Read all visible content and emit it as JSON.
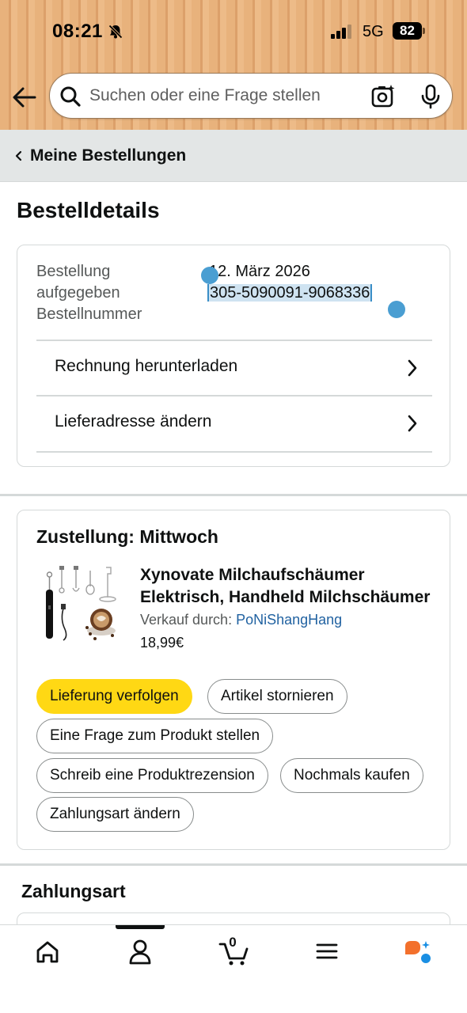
{
  "status_bar": {
    "time": "08:21",
    "network": "5G",
    "battery": "82"
  },
  "search": {
    "placeholder": "Suchen oder eine Frage stellen"
  },
  "breadcrumb": {
    "label": "Meine Bestellungen"
  },
  "page": {
    "title": "Bestelldetails"
  },
  "order_info": {
    "label_placed_line1": "Bestellung",
    "label_placed_line2": "aufgegeben",
    "label_number": "Bestellnummer",
    "date": "12. März 2026",
    "order_number": "305-5090091-9068336",
    "rows": [
      {
        "label": "Rechnung herunterladen"
      },
      {
        "label": "Lieferadresse ändern"
      }
    ]
  },
  "delivery": {
    "title": "Zustellung: Mittwoch",
    "product": {
      "title": "Xynovate Milchaufschäumer Elektrisch, Handheld Milchschäumer",
      "seller_prefix": "Verkauf durch: ",
      "seller": "PoNiShangHang",
      "price": "18,99€"
    },
    "actions": [
      "Lieferung verfolgen",
      "Artikel stornieren",
      "Eine Frage zum Produkt stellen",
      "Schreib eine Produktrezension",
      "Nochmals kaufen",
      "Zahlungsart ändern"
    ]
  },
  "payment": {
    "title": "Zahlungsart"
  },
  "bottom_nav": {
    "cart_count": "0"
  },
  "colors": {
    "primary_button": "#ffd814",
    "link": "#2162a1",
    "header": "#e8b27c"
  }
}
